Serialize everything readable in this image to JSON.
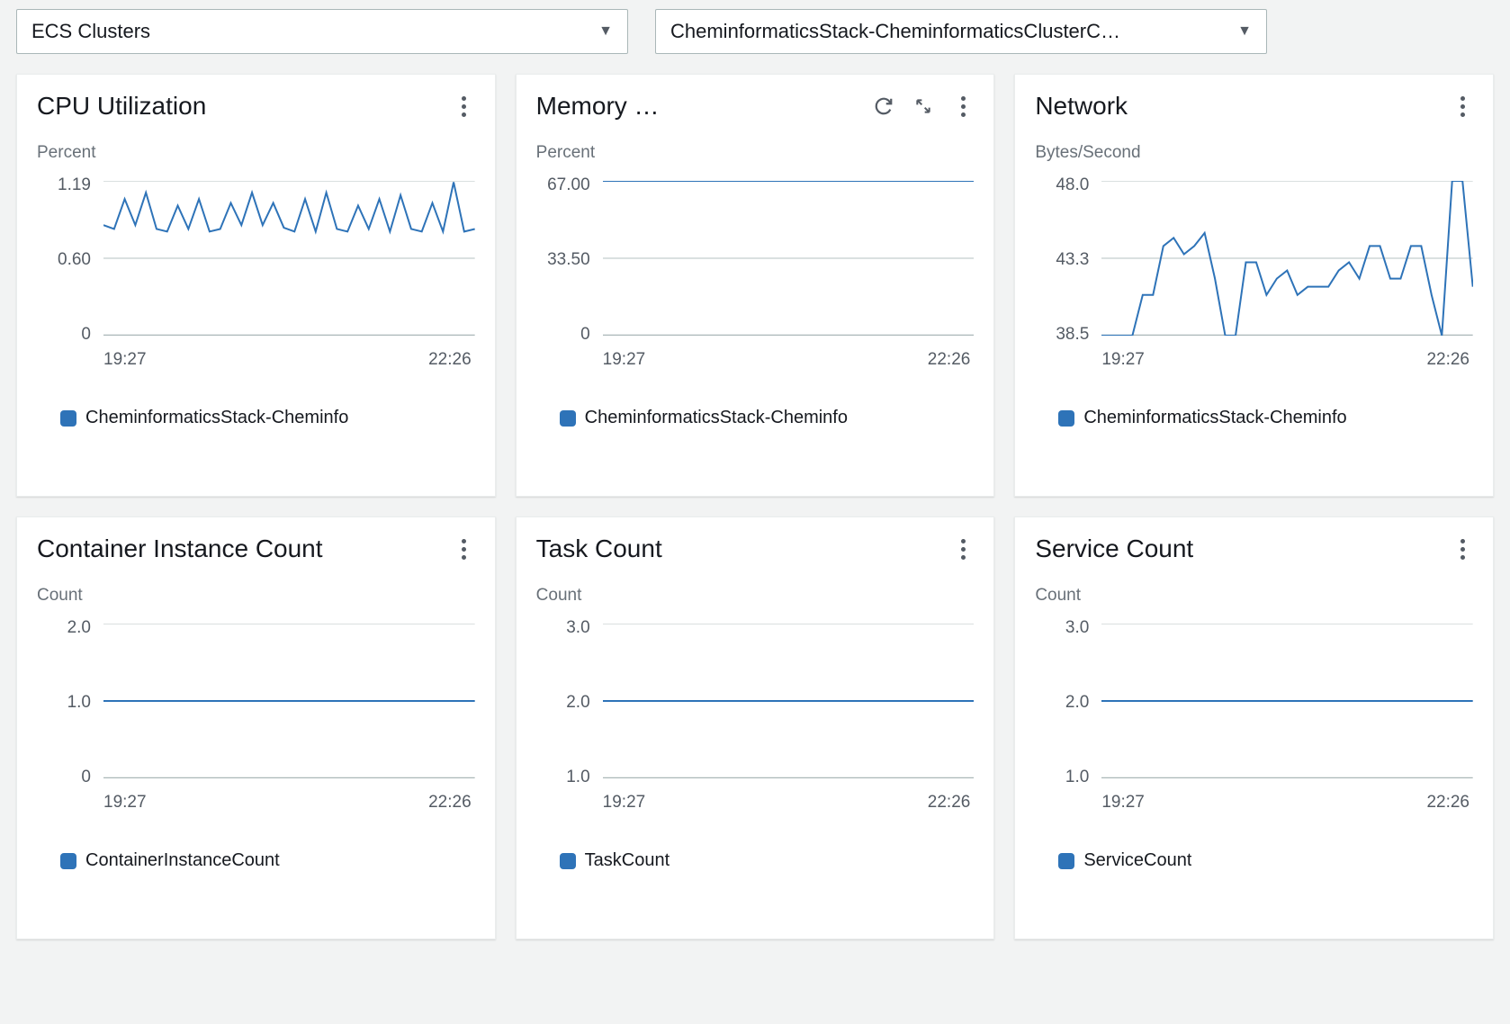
{
  "dropdowns": {
    "scope": "ECS Clusters",
    "resource": "CheminformaticsStack-CheminformaticsClusterC…"
  },
  "cards": [
    {
      "id": "cpu",
      "title": "CPU Utilization",
      "unit": "Percent",
      "yTicks": [
        "1.19",
        "0.60",
        "0"
      ],
      "xStart": "19:27",
      "xEnd": "22:26",
      "legend": "CheminformaticsStack-Cheminfo",
      "extraActions": false
    },
    {
      "id": "memory",
      "title": "Memory …",
      "unit": "Percent",
      "yTicks": [
        "67.00",
        "33.50",
        "0"
      ],
      "xStart": "19:27",
      "xEnd": "22:26",
      "legend": "CheminformaticsStack-Cheminfo",
      "extraActions": true
    },
    {
      "id": "network",
      "title": "Network",
      "unit": "Bytes/Second",
      "yTicks": [
        "48.0",
        "43.3",
        "38.5"
      ],
      "xStart": "19:27",
      "xEnd": "22:26",
      "legend": "CheminformaticsStack-Cheminfo",
      "extraActions": false
    },
    {
      "id": "container",
      "title": "Container Instance Count",
      "unit": "Count",
      "yTicks": [
        "2.0",
        "1.0",
        "0"
      ],
      "xStart": "19:27",
      "xEnd": "22:26",
      "legend": "ContainerInstanceCount",
      "extraActions": false
    },
    {
      "id": "task",
      "title": "Task Count",
      "unit": "Count",
      "yTicks": [
        "3.0",
        "2.0",
        "1.0"
      ],
      "xStart": "19:27",
      "xEnd": "22:26",
      "legend": "TaskCount",
      "extraActions": false
    },
    {
      "id": "service",
      "title": "Service Count",
      "unit": "Count",
      "yTicks": [
        "3.0",
        "2.0",
        "1.0"
      ],
      "xStart": "19:27",
      "xEnd": "22:26",
      "legend": "ServiceCount",
      "extraActions": false
    }
  ],
  "chart_data": [
    {
      "type": "line",
      "id": "cpu",
      "title": "CPU Utilization",
      "ylabel": "Percent",
      "ylim": [
        0,
        1.19
      ],
      "x_range": [
        "19:27",
        "22:26"
      ],
      "series": [
        {
          "name": "CheminformaticsStack-Cheminfo",
          "values": [
            0.85,
            0.82,
            1.05,
            0.85,
            1.1,
            0.82,
            0.8,
            1.0,
            0.82,
            1.05,
            0.8,
            0.82,
            1.02,
            0.85,
            1.1,
            0.85,
            1.02,
            0.83,
            0.8,
            1.05,
            0.8,
            1.1,
            0.82,
            0.8,
            1.0,
            0.82,
            1.05,
            0.8,
            1.08,
            0.82,
            0.8,
            1.02,
            0.8,
            1.18,
            0.8,
            0.82
          ]
        }
      ]
    },
    {
      "type": "line",
      "id": "memory",
      "title": "Memory …",
      "ylabel": "Percent",
      "ylim": [
        0,
        67.0
      ],
      "x_range": [
        "19:27",
        "22:26"
      ],
      "series": [
        {
          "name": "CheminformaticsStack-Cheminfo",
          "values": [
            67.0,
            67.0
          ]
        }
      ]
    },
    {
      "type": "line",
      "id": "network",
      "title": "Network",
      "ylabel": "Bytes/Second",
      "ylim": [
        38.5,
        48.0
      ],
      "x_range": [
        "19:27",
        "22:26"
      ],
      "series": [
        {
          "name": "CheminformaticsStack-Cheminfo",
          "values": [
            38.5,
            38.5,
            38.5,
            38.5,
            41.0,
            41.0,
            44.0,
            44.5,
            43.5,
            44.0,
            44.8,
            42.0,
            38.5,
            38.5,
            43.0,
            43.0,
            41.0,
            42.0,
            42.5,
            41.0,
            41.5,
            41.5,
            41.5,
            42.5,
            43.0,
            42.0,
            44.0,
            44.0,
            42.0,
            42.0,
            44.0,
            44.0,
            41.0,
            38.5,
            48.0,
            48.0,
            41.5
          ]
        }
      ]
    },
    {
      "type": "line",
      "id": "container",
      "title": "Container Instance Count",
      "ylabel": "Count",
      "ylim": [
        0,
        2.0
      ],
      "x_range": [
        "19:27",
        "22:26"
      ],
      "series": [
        {
          "name": "ContainerInstanceCount",
          "values": [
            1.0,
            1.0
          ]
        }
      ]
    },
    {
      "type": "line",
      "id": "task",
      "title": "Task Count",
      "ylabel": "Count",
      "ylim": [
        1.0,
        3.0
      ],
      "x_range": [
        "19:27",
        "22:26"
      ],
      "series": [
        {
          "name": "TaskCount",
          "values": [
            2.0,
            2.0
          ]
        }
      ]
    },
    {
      "type": "line",
      "id": "service",
      "title": "Service Count",
      "ylabel": "Count",
      "ylim": [
        1.0,
        3.0
      ],
      "x_range": [
        "19:27",
        "22:26"
      ],
      "series": [
        {
          "name": "ServiceCount",
          "values": [
            2.0,
            2.0
          ]
        }
      ]
    }
  ]
}
